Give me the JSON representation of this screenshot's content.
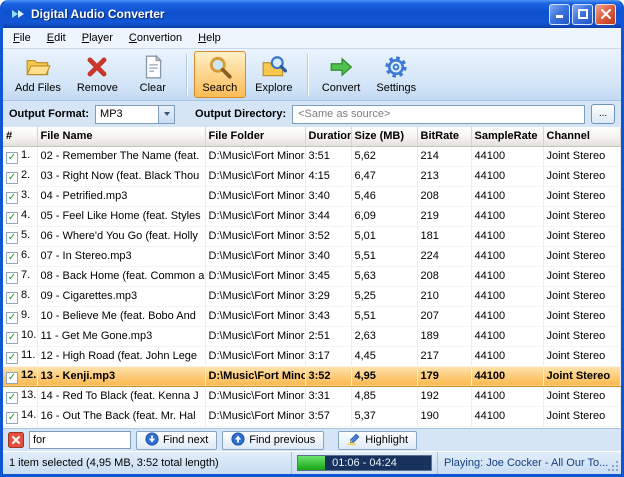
{
  "window": {
    "title": "Digital Audio Converter"
  },
  "menu": {
    "items": [
      "File",
      "Edit",
      "Player",
      "Convertion",
      "Help"
    ]
  },
  "toolbar": {
    "buttons": [
      {
        "label": "Add Files",
        "icon": "add-files-icon",
        "active": false,
        "separator_after": false
      },
      {
        "label": "Remove",
        "icon": "remove-icon",
        "active": false,
        "separator_after": false
      },
      {
        "label": "Clear",
        "icon": "clear-icon",
        "active": false,
        "separator_after": true
      },
      {
        "label": "Search",
        "icon": "search-icon",
        "active": true,
        "separator_after": false
      },
      {
        "label": "Explore",
        "icon": "explore-icon",
        "active": false,
        "separator_after": true
      },
      {
        "label": "Convert",
        "icon": "convert-icon",
        "active": false,
        "separator_after": false
      },
      {
        "label": "Settings",
        "icon": "settings-icon",
        "active": false,
        "separator_after": false
      }
    ]
  },
  "format_bar": {
    "output_format_label": "Output Format:",
    "output_format_value": "MP3",
    "output_directory_label": "Output Directory:",
    "output_directory_value": "<Same as source>",
    "browse_button_label": "..."
  },
  "table": {
    "columns": [
      "#",
      "File Name",
      "File Folder",
      "Duration",
      "Size (MB)",
      "BitRate",
      "SampleRate",
      "Channel"
    ],
    "rows": [
      {
        "num": "1.",
        "checked": true,
        "selected": false,
        "file_name": "02 - Remember The Name (feat.",
        "file_folder": "D:\\Music\\Fort Minor",
        "duration": "3:51",
        "size_mb": "5,62",
        "bitrate": "214",
        "samplerate": "44100",
        "channel": "Joint Stereo"
      },
      {
        "num": "2.",
        "checked": true,
        "selected": false,
        "file_name": "03 - Right Now (feat. Black Thou",
        "file_folder": "D:\\Music\\Fort Minor",
        "duration": "4:15",
        "size_mb": "6,47",
        "bitrate": "213",
        "samplerate": "44100",
        "channel": "Joint Stereo"
      },
      {
        "num": "3.",
        "checked": true,
        "selected": false,
        "file_name": "04 - Petrified.mp3",
        "file_folder": "D:\\Music\\Fort Minor",
        "duration": "3:40",
        "size_mb": "5,46",
        "bitrate": "208",
        "samplerate": "44100",
        "channel": "Joint Stereo"
      },
      {
        "num": "4.",
        "checked": true,
        "selected": false,
        "file_name": "05 - Feel Like Home (feat. Styles",
        "file_folder": "D:\\Music\\Fort Minor",
        "duration": "3:44",
        "size_mb": "6,09",
        "bitrate": "219",
        "samplerate": "44100",
        "channel": "Joint Stereo"
      },
      {
        "num": "5.",
        "checked": true,
        "selected": false,
        "file_name": "06 - Where'd You Go (feat. Holly",
        "file_folder": "D:\\Music\\Fort Minor",
        "duration": "3:52",
        "size_mb": "5,01",
        "bitrate": "181",
        "samplerate": "44100",
        "channel": "Joint Stereo"
      },
      {
        "num": "6.",
        "checked": true,
        "selected": false,
        "file_name": "07 - In Stereo.mp3",
        "file_folder": "D:\\Music\\Fort Minor",
        "duration": "3:40",
        "size_mb": "5,51",
        "bitrate": "224",
        "samplerate": "44100",
        "channel": "Joint Stereo"
      },
      {
        "num": "7.",
        "checked": true,
        "selected": false,
        "file_name": "08 - Back Home (feat. Common a",
        "file_folder": "D:\\Music\\Fort Minor",
        "duration": "3:45",
        "size_mb": "5,63",
        "bitrate": "208",
        "samplerate": "44100",
        "channel": "Joint Stereo"
      },
      {
        "num": "8.",
        "checked": true,
        "selected": false,
        "file_name": "09 - Cigarettes.mp3",
        "file_folder": "D:\\Music\\Fort Minor",
        "duration": "3:29",
        "size_mb": "5,25",
        "bitrate": "210",
        "samplerate": "44100",
        "channel": "Joint Stereo"
      },
      {
        "num": "9.",
        "checked": true,
        "selected": false,
        "file_name": "10 - Believe Me (feat. Bobo And",
        "file_folder": "D:\\Music\\Fort Minor",
        "duration": "3:43",
        "size_mb": "5,51",
        "bitrate": "207",
        "samplerate": "44100",
        "channel": "Joint Stereo"
      },
      {
        "num": "10.",
        "checked": true,
        "selected": false,
        "file_name": "11 - Get Me Gone.mp3",
        "file_folder": "D:\\Music\\Fort Minor",
        "duration": "2:51",
        "size_mb": "2,63",
        "bitrate": "189",
        "samplerate": "44100",
        "channel": "Joint Stereo"
      },
      {
        "num": "11.",
        "checked": true,
        "selected": false,
        "file_name": "12 - High Road (feat. John Lege",
        "file_folder": "D:\\Music\\Fort Minor",
        "duration": "3:17",
        "size_mb": "4,45",
        "bitrate": "217",
        "samplerate": "44100",
        "channel": "Joint Stereo"
      },
      {
        "num": "12.",
        "checked": true,
        "selected": true,
        "file_name": "13 - Kenji.mp3",
        "file_folder": "D:\\Music\\Fort Minor",
        "duration": "3:52",
        "size_mb": "4,95",
        "bitrate": "179",
        "samplerate": "44100",
        "channel": "Joint Stereo"
      },
      {
        "num": "13.",
        "checked": true,
        "selected": false,
        "file_name": "14 - Red To Black (feat. Kenna J",
        "file_folder": "D:\\Music\\Fort Minor",
        "duration": "3:31",
        "size_mb": "4,85",
        "bitrate": "192",
        "samplerate": "44100",
        "channel": "Joint Stereo"
      },
      {
        "num": "14.",
        "checked": true,
        "selected": false,
        "file_name": "16 - Out The Back (feat. Mr. Hal",
        "file_folder": "D:\\Music\\Fort Minor",
        "duration": "3:57",
        "size_mb": "5,37",
        "bitrate": "190",
        "samplerate": "44100",
        "channel": "Joint Stereo"
      }
    ]
  },
  "search_bar": {
    "query": "for",
    "find_next_label": "Find next",
    "find_previous_label": "Find previous",
    "highlight_label": "Highlight"
  },
  "status_bar": {
    "selection_text": "1 item selected (4,95 MB, 3:52 total length)",
    "playback_time": "01:06 - 04:24",
    "progress_percent": 20,
    "now_playing": "Playing: Joe Cocker - All Our To..."
  },
  "colors": {
    "titlebar_blue": "#0F55D4",
    "selection_orange": "#FBB94F",
    "active_tool_highlight": "#FDD388",
    "progress_green": "#14A614"
  }
}
